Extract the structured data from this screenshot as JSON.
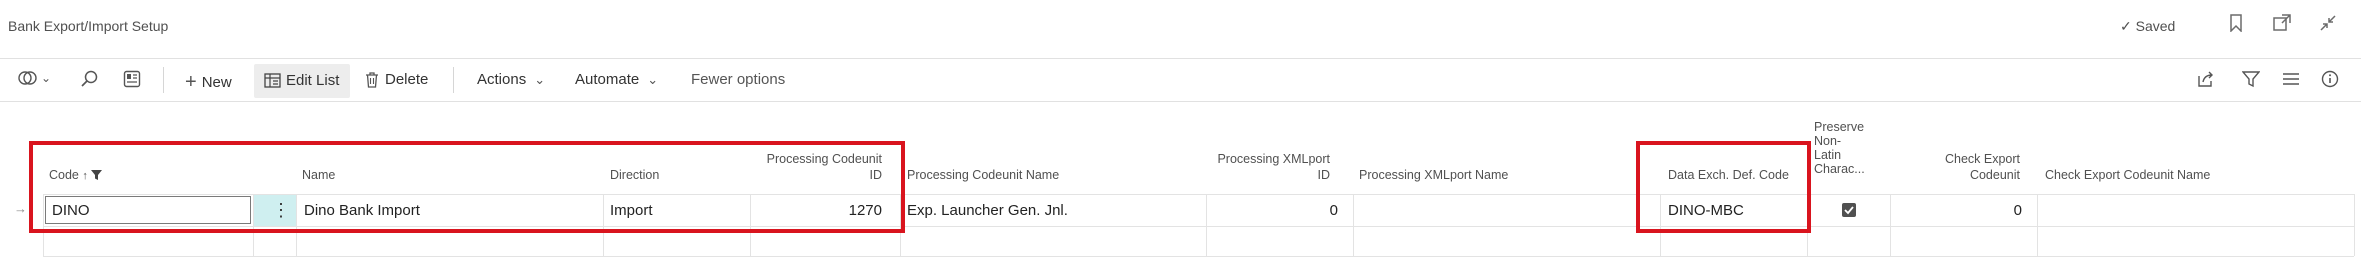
{
  "page": {
    "title": "Bank Export/Import Setup",
    "saved_label": "Saved"
  },
  "toolbar": {
    "new_label": "New",
    "edit_list_label": "Edit List",
    "delete_label": "Delete",
    "actions_label": "Actions",
    "automate_label": "Automate",
    "fewer_options_label": "Fewer options"
  },
  "columns": {
    "code": "Code",
    "name": "Name",
    "direction": "Direction",
    "proc_cu_id_1": "Processing Codeunit",
    "proc_cu_id_2": "ID",
    "proc_cu_name": "Processing Codeunit Name",
    "proc_xml_id_1": "Processing XMLport",
    "proc_xml_id_2": "ID",
    "proc_xml_name": "Processing XMLport Name",
    "data_exch": "Data Exch. Def. Code",
    "preserve_1": "Preserve",
    "preserve_2": "Non-",
    "preserve_3": "Latin",
    "preserve_4": "Charac...",
    "check_cu_id_1": "Check Export",
    "check_cu_id_2": "Codeunit",
    "check_cu_name": "Check Export Codeunit Name"
  },
  "rows": [
    {
      "code": "DINO",
      "name": "Dino Bank Import",
      "direction": "Import",
      "proc_cu_id": "1270",
      "proc_cu_name": "Exp. Launcher Gen. Jnl.",
      "proc_xml_id": "0",
      "proc_xml_name": "",
      "data_exch": "DINO-MBC",
      "preserve": true,
      "check_cu_id": "0",
      "check_cu_name": ""
    }
  ],
  "colors": {
    "accent": "#d9141e",
    "focus": "#00a3a3",
    "row_marker_bg": "#cfeff0"
  }
}
